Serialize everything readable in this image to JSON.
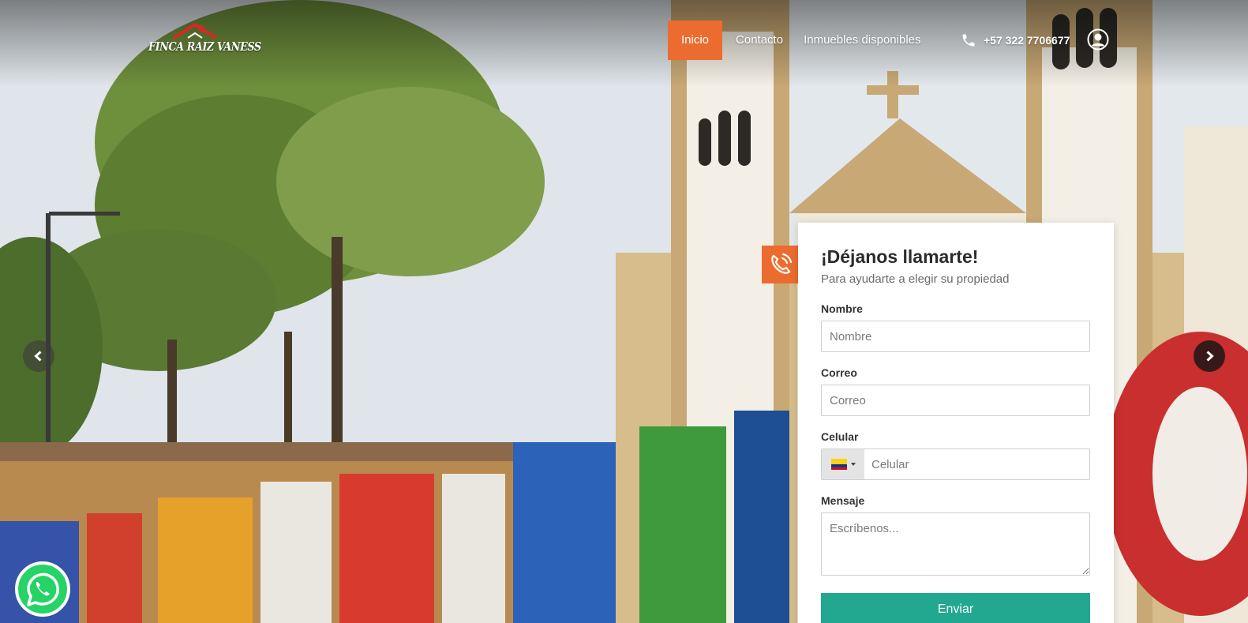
{
  "header": {
    "logo_text": "FINCA RAIZ VANESS",
    "nav": [
      {
        "label": "Inicio",
        "active": true
      },
      {
        "label": "Contacto",
        "active": false
      },
      {
        "label": "Inmuebles disponibles",
        "active": false
      }
    ],
    "phone": "+57 322 7706677",
    "phone_icon": "phone-icon",
    "user_icon": "user-circle-icon"
  },
  "carousel": {
    "prev_icon": "chevron-left-icon",
    "next_icon": "chevron-right-icon"
  },
  "contact_form": {
    "badge_icon": "phone-call-icon",
    "title": "¡Déjanos llamarte!",
    "subtitle": "Para ayudarte a elegir su propiedad",
    "name_label": "Nombre",
    "name_placeholder": "Nombre",
    "email_label": "Correo",
    "email_placeholder": "Correo",
    "phone_label": "Celular",
    "phone_placeholder": "Celular",
    "country_flag": "colombia-flag-icon",
    "message_label": "Mensaje",
    "message_placeholder": "Escríbenos...",
    "submit_label": "Enviar"
  },
  "floating": {
    "whatsapp_icon": "whatsapp-icon"
  },
  "colors": {
    "accent": "#ec6c2f",
    "submit": "#22a791",
    "whatsapp": "#25d366"
  }
}
